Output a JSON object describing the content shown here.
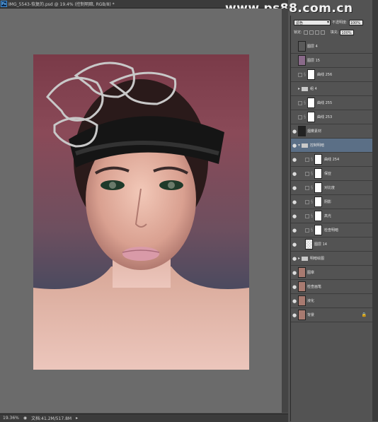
{
  "watermark": "www.ps88.com.cn",
  "document": {
    "title": "IMG_5543-恢复的.psd @ 19.4% (控制明暗, RGB/8) *",
    "zoom": "19.36%",
    "doc_info": "文档:41.2M/517.8M"
  },
  "layers_panel": {
    "blend_mode": "滤色",
    "opacity_label": "不透明度:",
    "opacity_value": "100%",
    "lock_label": "锁定:",
    "fill_label": "填充:",
    "fill_value": "100%",
    "layers": [
      {
        "name": "图层 4",
        "visible": false,
        "thumb": "#5a5a5a"
      },
      {
        "name": "图层 15",
        "visible": false,
        "thumb": "#8a6a8a"
      },
      {
        "name": "曲线 256",
        "visible": false,
        "thumb": "adj"
      },
      {
        "name": "组 4",
        "visible": false,
        "thumb": "folder"
      },
      {
        "name": "曲线 255",
        "visible": false,
        "thumb": "adj"
      },
      {
        "name": "曲线 253",
        "visible": false,
        "thumb": "adj"
      },
      {
        "name": "烟雾素材",
        "visible": true,
        "thumb": "#222"
      },
      {
        "name": "控制明暗",
        "visible": true,
        "thumb": "folder"
      },
      {
        "name": "曲线 254",
        "visible": true,
        "thumb": "adj"
      },
      {
        "name": "保亚",
        "visible": true,
        "thumb": "adj"
      },
      {
        "name": "对比度",
        "visible": true,
        "thumb": "adj"
      },
      {
        "name": "阴影",
        "visible": true,
        "thumb": "adj"
      },
      {
        "name": "高光",
        "visible": true,
        "thumb": "adj"
      },
      {
        "name": "检查明暗",
        "visible": true,
        "thumb": "adj"
      },
      {
        "name": "图层 14",
        "visible": true,
        "thumb": "checker"
      },
      {
        "name": "明暗绘图",
        "visible": true,
        "thumb": "folder"
      },
      {
        "name": "图章",
        "visible": true,
        "thumb": "#a87a70"
      },
      {
        "name": "检查画笔",
        "visible": true,
        "thumb": "#a87a70"
      },
      {
        "name": "液化",
        "visible": true,
        "thumb": "#a87a70"
      },
      {
        "name": "背景",
        "visible": true,
        "thumb": "#a87a70"
      }
    ]
  }
}
